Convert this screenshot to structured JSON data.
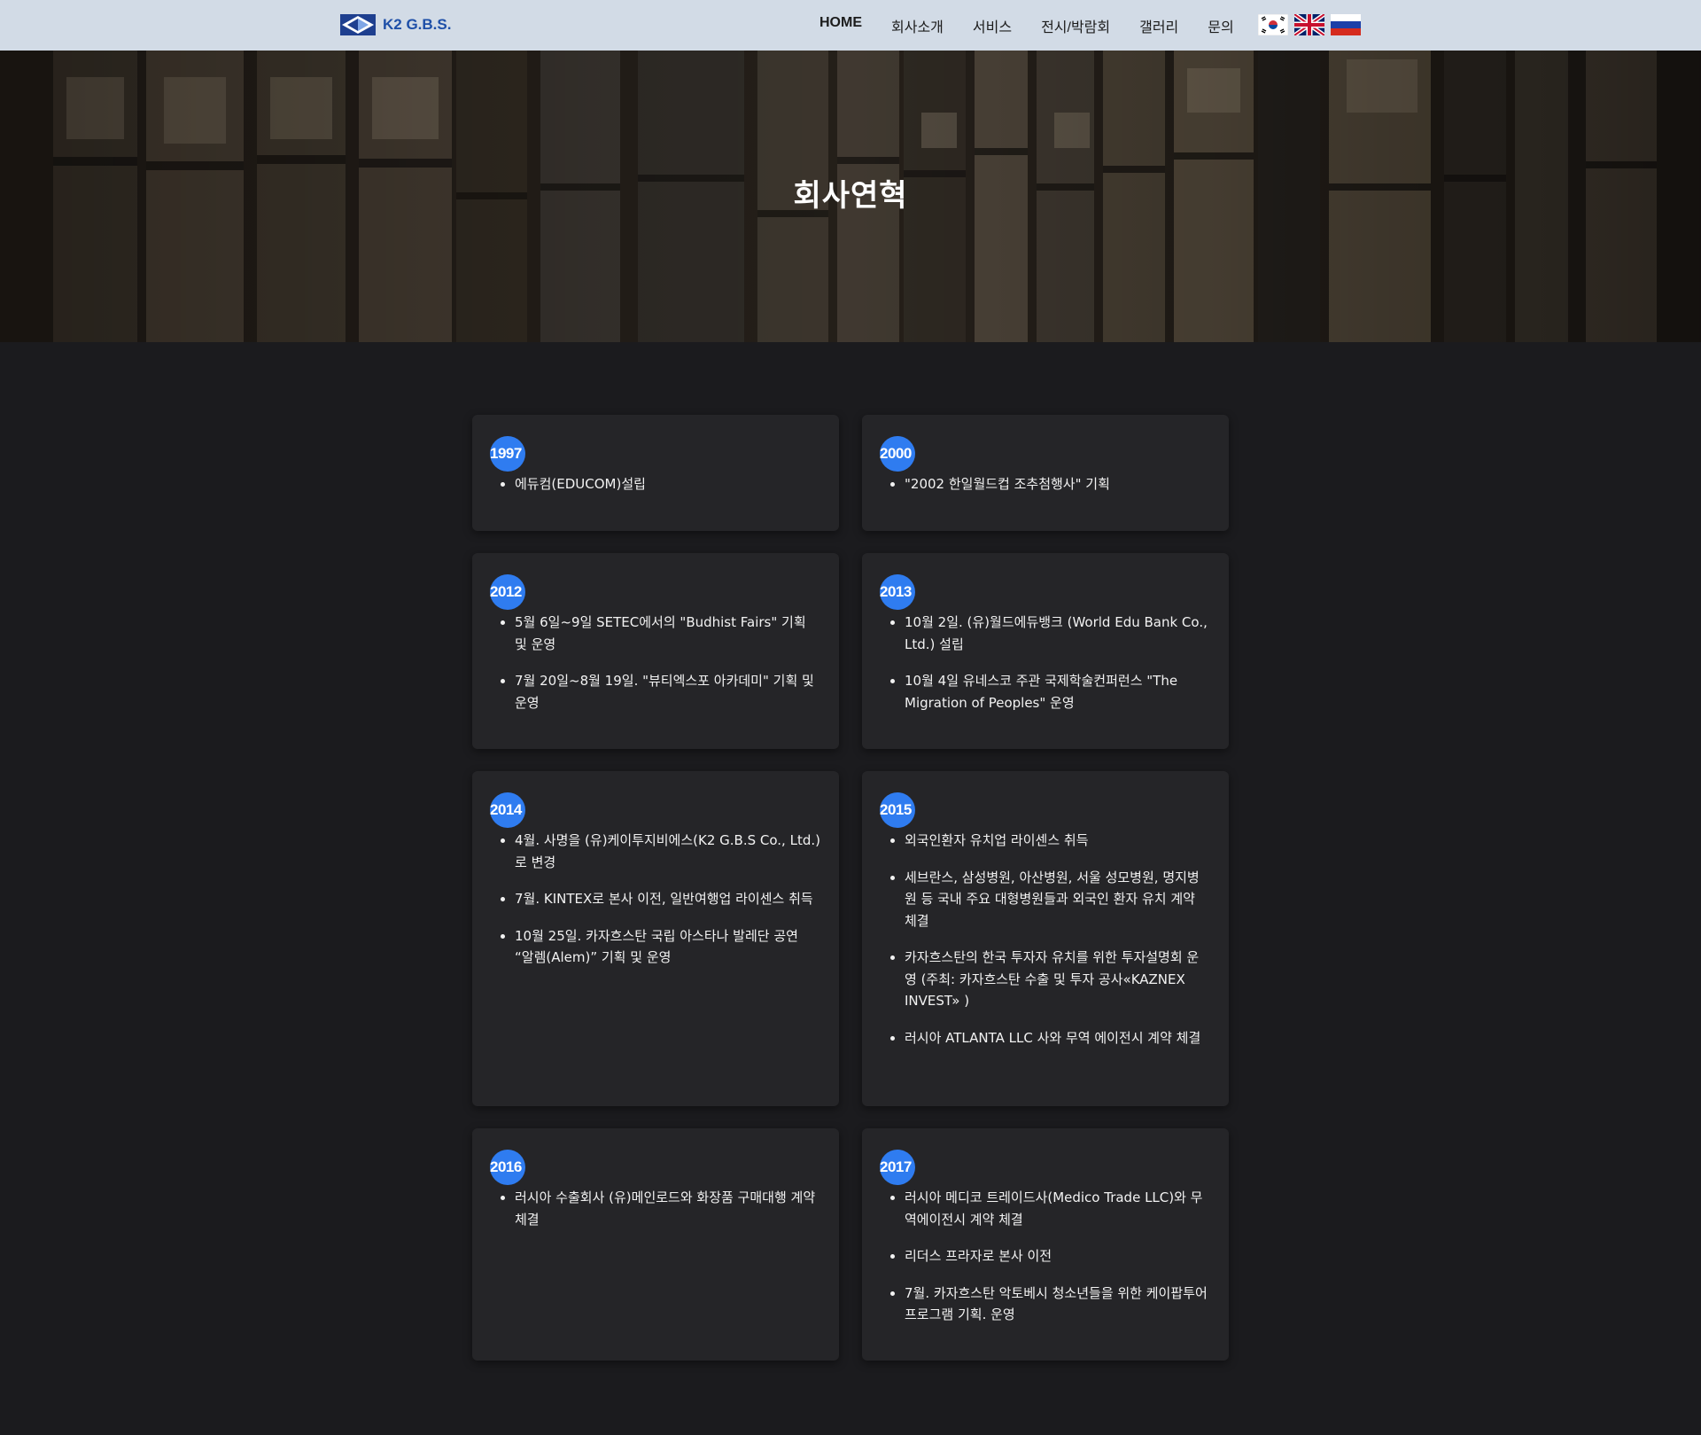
{
  "header": {
    "brand": "K2 G.B.S.",
    "nav": [
      "HOME",
      "회사소개",
      "서비스",
      "전시/박람회",
      "갤러리",
      "문의"
    ],
    "active_nav": "HOME",
    "languages": [
      "korea-flag-icon",
      "uk-flag-icon",
      "russia-flag-icon"
    ]
  },
  "hero": {
    "title": "회사연혁"
  },
  "colors": {
    "accent": "#2f7cf0",
    "card_bg": "#252528",
    "page_bg": "#1b1b1e",
    "header_bg": "#d2dbe6"
  },
  "timeline": [
    {
      "year": "1997",
      "items": [
        "에듀컴(EDUCOM)설립"
      ]
    },
    {
      "year": "2000",
      "items": [
        "\"2002 한일월드컵 조추첨행사\" 기획"
      ]
    },
    {
      "year": "2012",
      "items": [
        "5월 6일~9일 SETEC에서의 \"Budhist Fairs\" 기획 및 운영",
        "7월 20일~8월 19일. \"뷰티엑스포 아카데미\" 기획 및 운영"
      ]
    },
    {
      "year": "2013",
      "items": [
        "10월 2일. (유)월드에듀뱅크 (World Edu Bank Co., Ltd.) 설립",
        "10월 4일 유네스코 주관 국제학술컨퍼런스 \"The Migration of Peoples\" 운영"
      ]
    },
    {
      "year": "2014",
      "items": [
        "4월. 사명을 (유)케이투지비에스(K2 G.B.S Co., Ltd.)로 변경",
        "7월. KINTEX로 본사 이전, 일반여행업 라이센스 취득",
        "10월 25일. 카자흐스탄 국립 아스타나 발레단 공연 “알렘(Alem)” 기획 및 운영"
      ]
    },
    {
      "year": "2015",
      "items": [
        "외국인환자 유치업 라이센스 취득",
        "세브란스, 삼성병원, 아산병원, 서울 성모병원, 명지병원 등 국내 주요 대형병원들과 외국인 환자 유치 계약 체결",
        "카자흐스탄의 한국 투자자 유치를 위한 투자설명회 운영 (주최: 카자흐스탄 수출 및 투자 공사«KAZNEX INVEST» )",
        "러시아 ATLANTA LLC 사와 무역 에이전시 계약 체결"
      ]
    },
    {
      "year": "2016",
      "items": [
        "러시아 수출회사 (유)메인로드와 화장품 구매대행 계약 체결"
      ]
    },
    {
      "year": "2017",
      "items": [
        "러시아 메디코 트레이드사(Medico Trade LLC)와 무역에이전시 계약 체결",
        "리더스 프라자로 본사 이전",
        "7월. 카자흐스탄 악토베시 청소년들을 위한 케이팝투어 프로그램 기획. 운영"
      ]
    }
  ]
}
